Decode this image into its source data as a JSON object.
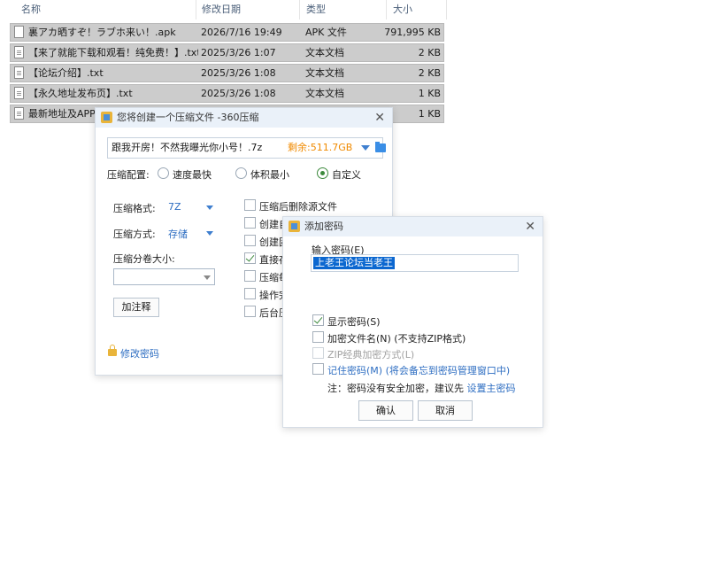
{
  "explorer": {
    "columns": {
      "name": "名称",
      "date": "修改日期",
      "type": "类型",
      "size": "大小"
    },
    "files": [
      {
        "name": "裏アカ晒すぞ！ラブホ来い！.apk",
        "date": "2026/7/16 19:49",
        "type": "APK 文件",
        "size": "791,995 KB"
      },
      {
        "name": "【来了就能下载和观看！纯免费！】.txt",
        "date": "2025/3/26 1:07",
        "type": "文本文档",
        "size": "2 KB"
      },
      {
        "name": "【论坛介绍】.txt",
        "date": "2025/3/26 1:08",
        "type": "文本文档",
        "size": "2 KB"
      },
      {
        "name": "【永久地址发布页】.txt",
        "date": "2025/3/26 1:08",
        "type": "文本文档",
        "size": "1 KB"
      },
      {
        "name": "最新地址及APP请",
        "date": "",
        "type": "",
        "size": "1 KB"
      }
    ]
  },
  "compress_dialog": {
    "title": "您将创建一个压缩文件 -360压缩",
    "close": "✕",
    "path": "跟我开房！不然我曝光你小号！.7z",
    "remaining": "剩余:511.7GB",
    "config_label": "压缩配置:",
    "modes": [
      "速度最快",
      "体积最小",
      "自定义"
    ],
    "format_label": "压缩格式:",
    "format_value": "7Z",
    "method_label": "压缩方式:",
    "method_value": "存储",
    "volume_label": "压缩分卷大小:",
    "comment_button": "加注释",
    "options": [
      "压缩后删除源文件",
      "创建自",
      "创建固",
      "直接存",
      "压缩每",
      "操作完",
      "后台压"
    ],
    "change_password": "修改密码"
  },
  "password_dialog": {
    "title": "添加密码",
    "close": "✕",
    "input_label": "输入密码(E)",
    "password_value": "上老王论坛当老王",
    "show_password": "显示密码(S)",
    "encrypt_names": "加密文件名(N) (不支持ZIP格式)",
    "zip_classic": "ZIP经典加密方式(L)",
    "remember": "记住密码(M) (将会备忘到密码管理窗口中)",
    "note_prefix": "注：密码没有安全加密，建议先 ",
    "note_link": "设置主密码",
    "ok": "确认",
    "cancel": "取消"
  }
}
